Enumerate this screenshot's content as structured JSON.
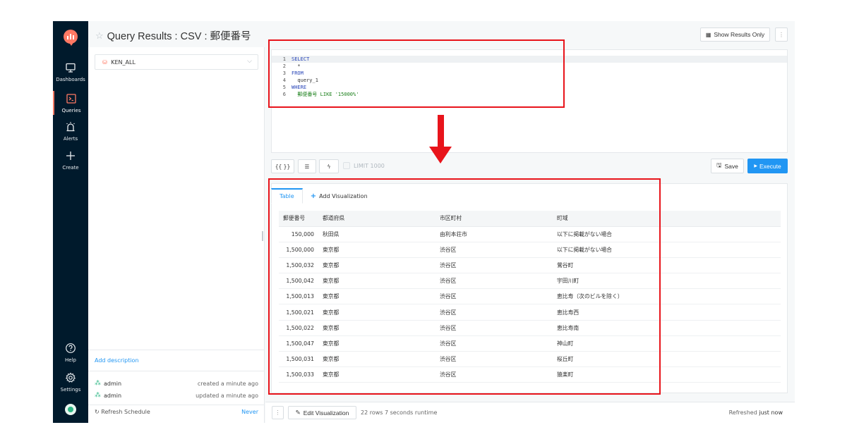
{
  "nav": {
    "items": [
      {
        "label": "Dashboards",
        "icon": "monitor-icon"
      },
      {
        "label": "Queries",
        "icon": "terminal-icon"
      },
      {
        "label": "Alerts",
        "icon": "alarm-icon"
      },
      {
        "label": "Create",
        "icon": "plus-icon"
      }
    ],
    "bottom": [
      {
        "label": "Help",
        "icon": "help-icon"
      },
      {
        "label": "Settings",
        "icon": "gear-icon"
      }
    ]
  },
  "header": {
    "title": "Query Results : CSV : 郵便番号",
    "show_results_only": "Show Results Only",
    "more": "⋮"
  },
  "datasource": {
    "name": "KEN_ALL"
  },
  "editor": {
    "lines": [
      {
        "n": "1",
        "text": "SELECT"
      },
      {
        "n": "2",
        "text": "  *"
      },
      {
        "n": "3",
        "text": "FROM"
      },
      {
        "n": "4",
        "text": "  query_1"
      },
      {
        "n": "5",
        "text": "WHERE"
      },
      {
        "n": "6",
        "text": "  郵便番号 LIKE '15000%'"
      }
    ]
  },
  "toolbar": {
    "params": "{{ }}",
    "limit_label": "LIMIT 1000",
    "save": "Save",
    "execute": "Execute"
  },
  "tabs": {
    "table": "Table",
    "add_viz": "Add Visualization"
  },
  "table": {
    "columns": [
      "郵便番号",
      "都道府県",
      "市区町村",
      "町域"
    ],
    "rows": [
      [
        "150,000",
        "秋田県",
        "由利本荘市",
        "以下に掲載がない場合"
      ],
      [
        "1,500,000",
        "東京都",
        "渋谷区",
        "以下に掲載がない場合"
      ],
      [
        "1,500,032",
        "東京都",
        "渋谷区",
        "鶯谷町"
      ],
      [
        "1,500,042",
        "東京都",
        "渋谷区",
        "宇田川町"
      ],
      [
        "1,500,013",
        "東京都",
        "渋谷区",
        "恵比寿（次のビルを除く）"
      ],
      [
        "1,500,021",
        "東京都",
        "渋谷区",
        "恵比寿西"
      ],
      [
        "1,500,022",
        "東京都",
        "渋谷区",
        "恵比寿南"
      ],
      [
        "1,500,047",
        "東京都",
        "渋谷区",
        "神山町"
      ],
      [
        "1,500,031",
        "東京都",
        "渋谷区",
        "桜丘町"
      ],
      [
        "1,500,033",
        "東京都",
        "渋谷区",
        "猿楽町"
      ]
    ]
  },
  "left": {
    "add_description": "Add description",
    "created_by": "admin",
    "created_when": "created a minute ago",
    "updated_by": "admin",
    "updated_when": "updated a minute ago",
    "refresh_label": "Refresh Schedule",
    "refresh_value": "Never"
  },
  "footer": {
    "edit_viz": "Edit Visualization",
    "runtime": "22 rows 7 seconds runtime",
    "refreshed_prefix": "Refreshed",
    "refreshed_value": "just now"
  },
  "colors": {
    "accent": "#2196f3",
    "brand": "#ff7964",
    "annotation": "#e8141b",
    "nav_bg": "#001a2c"
  }
}
